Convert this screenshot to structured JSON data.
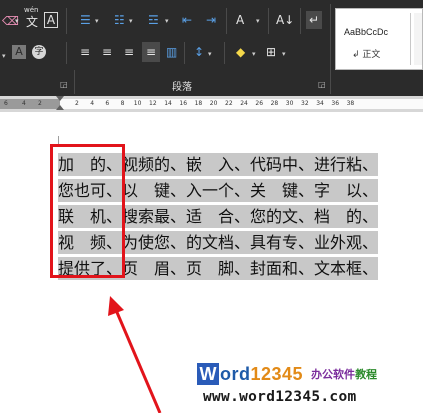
{
  "ribbon": {
    "row1": [
      {
        "name": "eraser-icon",
        "glyph": "⌫"
      },
      {
        "name": "phonetic-guide-icon",
        "glyph": "文"
      },
      {
        "name": "character-border-icon",
        "glyph": "A"
      },
      {
        "name": "bullets-icon",
        "glyph": "☰"
      },
      {
        "name": "numbering-icon",
        "glyph": "☷"
      },
      {
        "name": "multilevel-list-icon",
        "glyph": "☲"
      },
      {
        "name": "decrease-indent-icon",
        "glyph": "⇤"
      },
      {
        "name": "increase-indent-icon",
        "glyph": "⇥"
      },
      {
        "name": "chinese-layout-icon",
        "glyph": "A"
      },
      {
        "name": "sort-icon",
        "glyph": "A↓"
      },
      {
        "name": "show-paragraph-marks-icon",
        "glyph": "↵"
      }
    ],
    "row2": [
      {
        "name": "character-shading-icon",
        "glyph": "A"
      },
      {
        "name": "enclose-characters-icon",
        "glyph": "字"
      },
      {
        "name": "align-left-icon",
        "glyph": "≡"
      },
      {
        "name": "align-center-icon",
        "glyph": "≡"
      },
      {
        "name": "align-right-icon",
        "glyph": "≡"
      },
      {
        "name": "justify-icon",
        "glyph": "≡"
      },
      {
        "name": "distributed-icon",
        "glyph": "▥"
      },
      {
        "name": "line-spacing-icon",
        "glyph": "↕"
      },
      {
        "name": "shading-icon",
        "glyph": "◆"
      },
      {
        "name": "borders-icon",
        "glyph": "⊞"
      }
    ],
    "phonetic_label": "wén",
    "group_label": "段落",
    "styles_gallery": {
      "sample": "AaBbCcDc",
      "style_name": "↲ 正文"
    }
  },
  "ruler": {
    "left_ticks": [
      "6",
      "4",
      "2"
    ],
    "right_ticks": [
      "2",
      "4",
      "6",
      "8",
      "10",
      "12",
      "14",
      "16",
      "18",
      "20",
      "22",
      "24",
      "26",
      "28",
      "30",
      "32",
      "34",
      "36",
      "38"
    ]
  },
  "document": {
    "lines": [
      "加　的、视频的、嵌　入、代码中、进行粘、",
      "您也可、以　键、入一个、关　键、字　以、",
      "联　机、搜索最、适　合、您的文、档　的、",
      "视　频、为使您、的文档、具有专、业外观、",
      "提供了、页　眉、页　脚、封面和、文本框、"
    ]
  },
  "watermark": {
    "logo_w": "W",
    "logo_ord": "ord",
    "logo_nums": "12345",
    "tag1": "办公软件",
    "tag2": "教程",
    "url": "www.word12345.com"
  },
  "colors": {
    "ribbon_bg": "#2b2b2b",
    "selection": "#c8c8c8",
    "annotation_red": "#e2141b",
    "logo_blue": "#2a5bb8",
    "logo_orange": "#e28a17"
  }
}
